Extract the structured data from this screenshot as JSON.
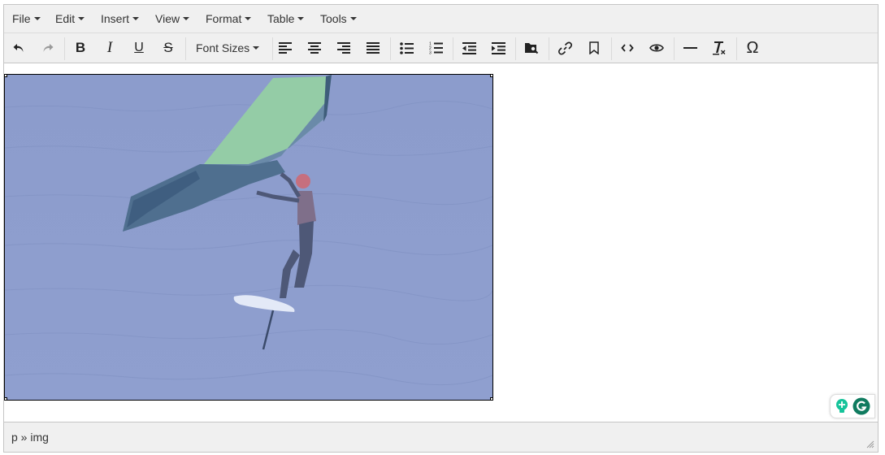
{
  "menubar": {
    "items": [
      {
        "label": "File"
      },
      {
        "label": "Edit"
      },
      {
        "label": "Insert"
      },
      {
        "label": "View"
      },
      {
        "label": "Format"
      },
      {
        "label": "Table"
      },
      {
        "label": "Tools"
      }
    ]
  },
  "toolbar": {
    "font_sizes_label": "Font Sizes",
    "buttons": [
      "undo",
      "redo",
      "bold",
      "italic",
      "underline",
      "strikethrough",
      "font-sizes",
      "align-left",
      "align-center",
      "align-right",
      "align-justify",
      "bullet-list",
      "numbered-list",
      "outdent",
      "indent",
      "search-replace",
      "link",
      "bookmark",
      "source-code",
      "preview",
      "horizontal-rule",
      "clear-formatting",
      "special-character"
    ],
    "bold_glyph": "B",
    "italic_glyph": "I",
    "underline_glyph": "U",
    "strike_glyph": "S",
    "omega_glyph": "Ω"
  },
  "content": {
    "image": {
      "kind": "photo",
      "subject": "wing foil surfer on water",
      "tint": "#8d9fcf"
    }
  },
  "statusbar": {
    "path": "p » img"
  },
  "colors": {
    "bar_bg": "#f0f0f0",
    "border": "#c5c5c5",
    "image_tint": "#8e9fcf",
    "grammarly_green": "#15c39a",
    "grammarly_dark": "#0f7b5f"
  }
}
